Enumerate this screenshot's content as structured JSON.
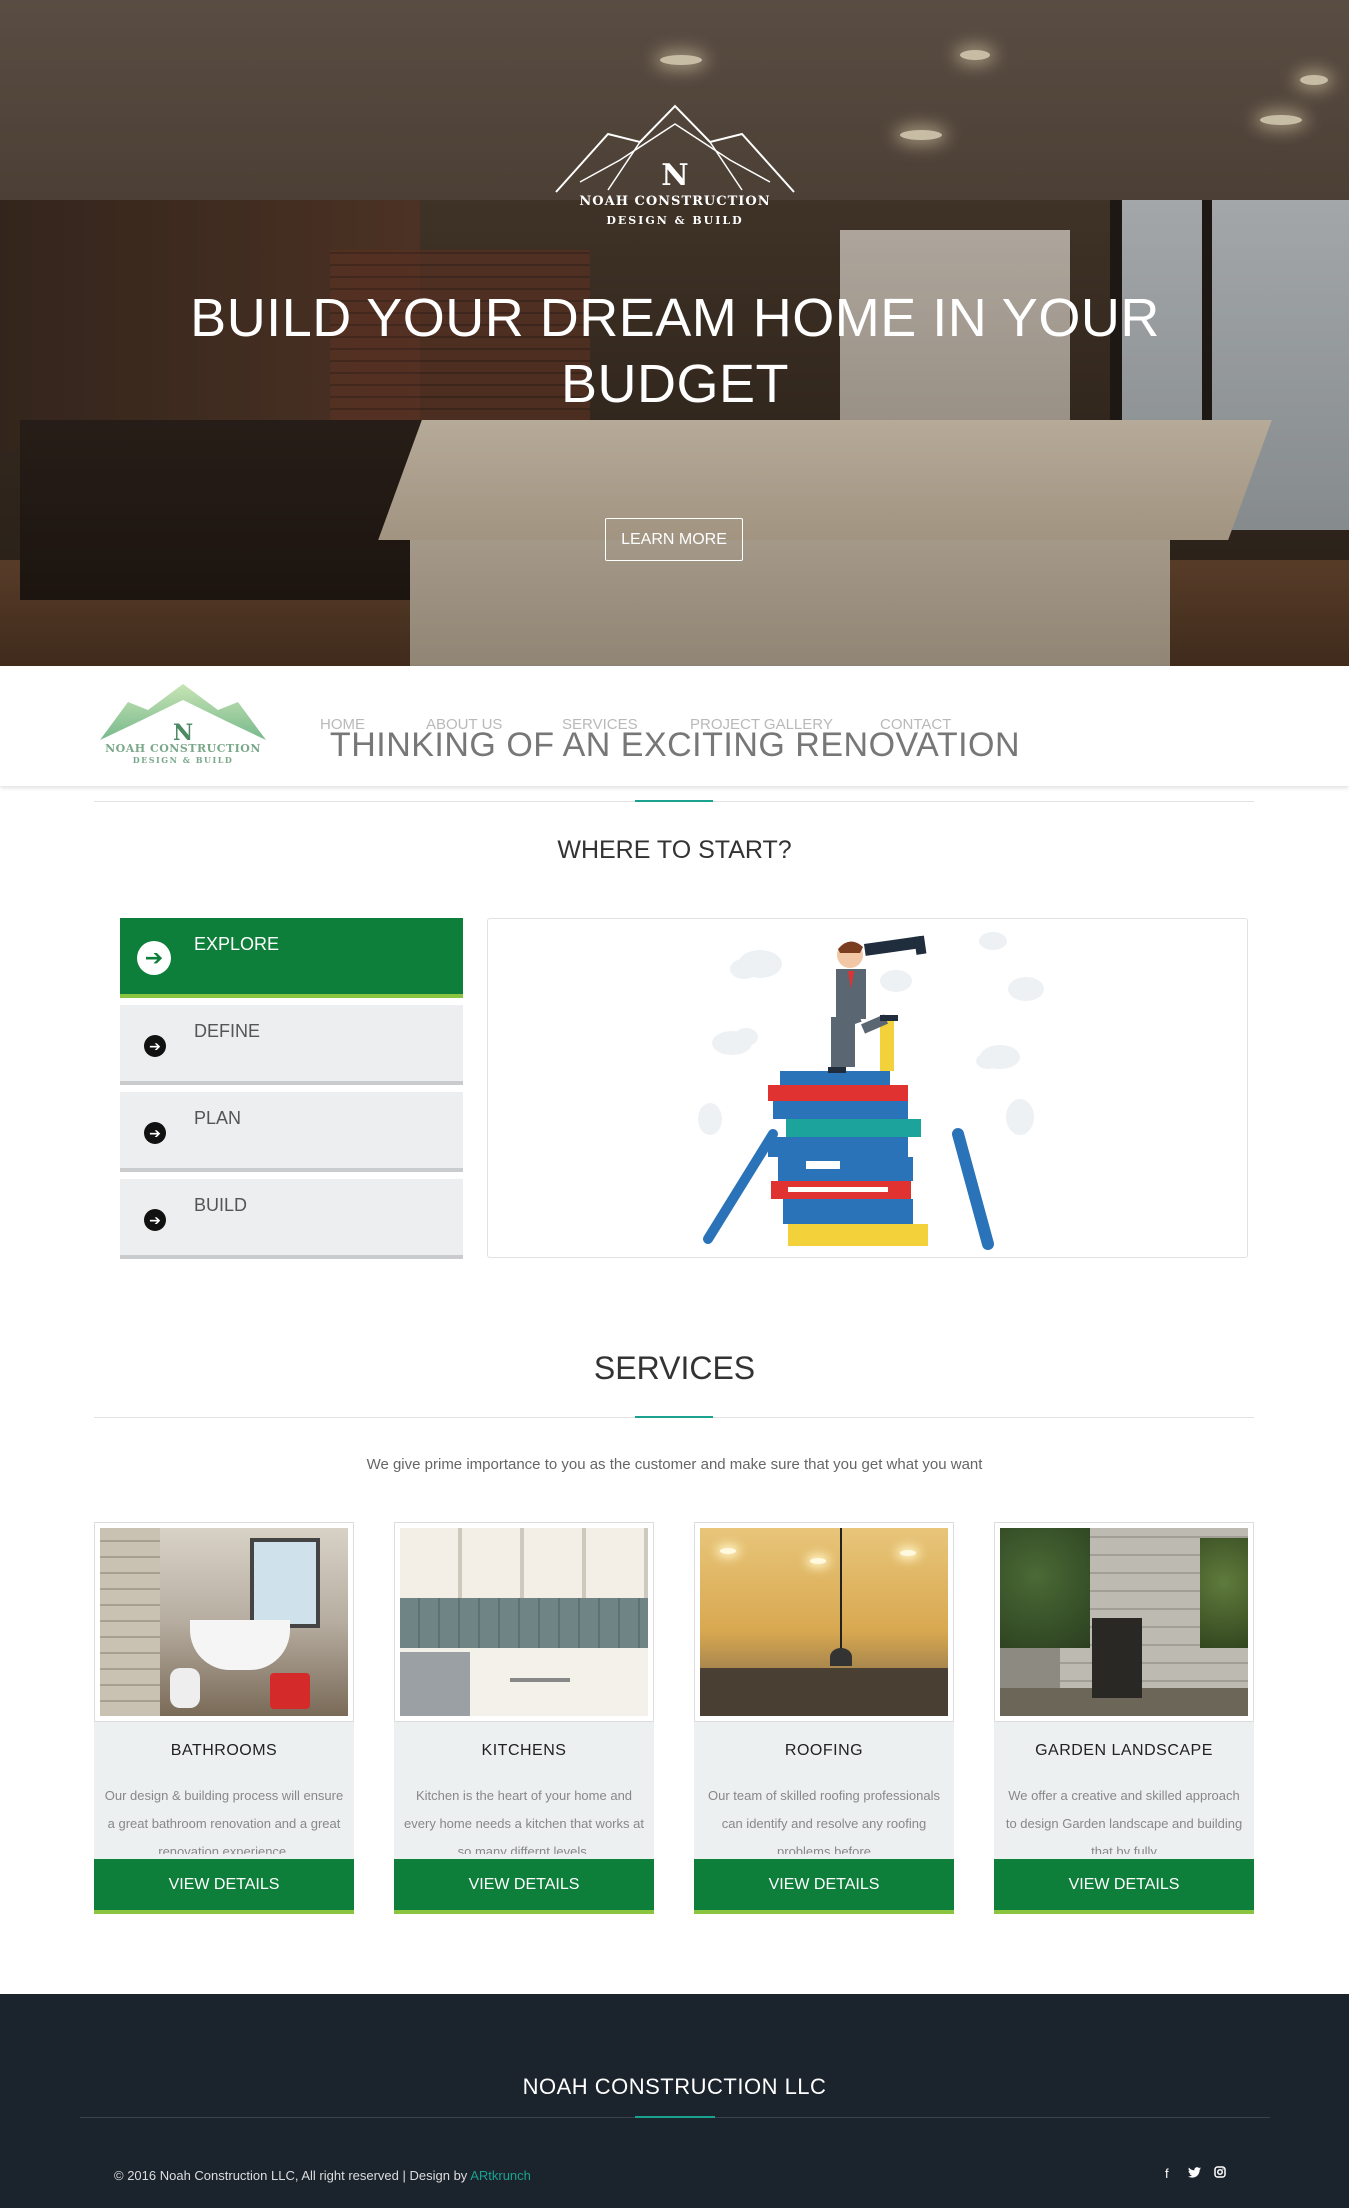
{
  "hero": {
    "logo_brand": "NOAH CONSTRUCTION",
    "logo_sub": "DESIGN & BUILD",
    "logo_letter": "N",
    "title": "BUILD YOUR DREAM HOME IN YOUR BUDGET",
    "cta_label": "LEARN MORE"
  },
  "nav": {
    "logo_brand": "NOAH CONSTRUCTION",
    "logo_sub": "DESIGN & BUILD",
    "logo_letter": "N",
    "links": [
      "HOME",
      "ABOUT US",
      "SERVICES",
      "PROJECT GALLERY",
      "CONTACT"
    ],
    "overlay_heading": "THINKING OF AN EXCITING RENOVATION"
  },
  "start": {
    "title": "WHERE TO START?",
    "steps": [
      {
        "label": "EXPLORE",
        "active": true
      },
      {
        "label": "DEFINE",
        "active": false
      },
      {
        "label": "PLAN",
        "active": false
      },
      {
        "label": "BUILD",
        "active": false
      }
    ]
  },
  "services": {
    "title": "SERVICES",
    "lead": "We give prime importance to you as the customer and make sure that you get what you want",
    "cards": [
      {
        "title": "BATHROOMS",
        "desc": "Our design & building process will ensure a great bathroom renovation and a great renovation experience.",
        "button": "VIEW DETAILS"
      },
      {
        "title": "KITCHENS",
        "desc": "Kitchen is the heart of your home and every home needs a kitchen that works at so many differnt levels.",
        "button": "VIEW DETAILS"
      },
      {
        "title": "ROOFING",
        "desc": "Our team of skilled roofing professionals can identify and resolve any roofing problems before",
        "button": "VIEW DETAILS"
      },
      {
        "title": "GARDEN LANDSCAPE",
        "desc": "We offer a creative and skilled approach to design Garden landscape and building that by fully",
        "button": "VIEW DETAILS"
      }
    ]
  },
  "footer": {
    "name": "NOAH CONSTRUCTION LLC",
    "copyright": "© 2016 Noah Construction LLC, All right reserved | Design by ",
    "designer": "ARtkrunch",
    "social": [
      "f",
      "t",
      "ig"
    ]
  },
  "colors": {
    "brand_green": "#0d7f3a",
    "accent_lime": "#8bc53f",
    "accent_teal": "#1aa28e",
    "footer_bg": "#1b232d"
  },
  "icons": [
    "arrow-right-circle-icon",
    "facebook-icon",
    "twitter-icon",
    "instagram-icon"
  ]
}
